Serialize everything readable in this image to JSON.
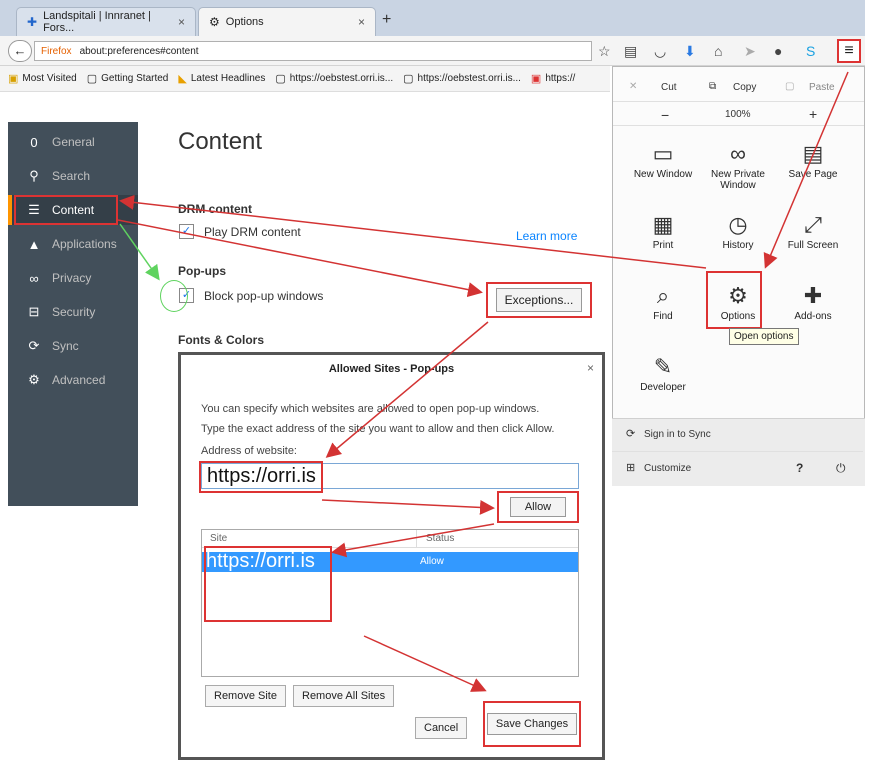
{
  "tabs": [
    {
      "label": "Landspitali | Innranet | Fors...",
      "close": "×",
      "icon": "globe-icon"
    },
    {
      "label": "Options",
      "close": "×",
      "icon": "gear-icon"
    }
  ],
  "new_tab": "+",
  "nav": {
    "back": "←",
    "identity": "Firefox",
    "url": "about:preferences#content",
    "icons": [
      "star-icon",
      "reading-list-icon",
      "pocket-icon",
      "download-icon",
      "home-icon",
      "send-icon",
      "chat-icon",
      "skype-icon"
    ],
    "menu": "≡"
  },
  "bookmarks": [
    {
      "label": "Most Visited",
      "icon": "bookmark-icon"
    },
    {
      "label": "Getting Started",
      "icon": "page-icon"
    },
    {
      "label": "Latest Headlines",
      "icon": "rss-icon"
    },
    {
      "label": "https://oebstest.orri.is...",
      "icon": "page-icon"
    },
    {
      "label": "https://oebstest.orri.is...",
      "icon": "page-icon"
    },
    {
      "label": "https://",
      "icon": "page-icon"
    }
  ],
  "sidebar": {
    "items": [
      {
        "label": "General",
        "icon": "0"
      },
      {
        "label": "Search",
        "icon": "🔍"
      },
      {
        "label": "Content",
        "icon": "☰"
      },
      {
        "label": "Applications",
        "icon": "▲"
      },
      {
        "label": "Privacy",
        "icon": "∞"
      },
      {
        "label": "Security",
        "icon": "🔒"
      },
      {
        "label": "Sync",
        "icon": "⟳"
      },
      {
        "label": "Advanced",
        "icon": "⚙"
      }
    ]
  },
  "content": {
    "title": "Content",
    "drm_heading": "DRM content",
    "drm_label": "Play DRM content",
    "learn_more": "Learn more",
    "popups_heading": "Pop-ups",
    "popups_label": "Block pop-up windows",
    "exceptions": "Exceptions...",
    "fonts_heading": "Fonts & Colors"
  },
  "menu": {
    "edit": {
      "cut": "Cut",
      "copy": "Copy",
      "paste": "Paste"
    },
    "zoom": {
      "minus": "−",
      "level": "100%",
      "plus": "+"
    },
    "items": [
      {
        "label": "New Window",
        "icon": "▭"
      },
      {
        "label": "New Private Window",
        "icon": "∞"
      },
      {
        "label": "Save Page",
        "icon": "▤"
      },
      {
        "label": "Print",
        "icon": "▦"
      },
      {
        "label": "History",
        "icon": "◷"
      },
      {
        "label": "Full Screen",
        "icon": "⤢"
      },
      {
        "label": "Find",
        "icon": "⌕"
      },
      {
        "label": "Options",
        "icon": "⚙"
      },
      {
        "label": "Add-ons",
        "icon": "✚"
      },
      {
        "label": "Developer",
        "icon": "✎"
      }
    ],
    "tooltip": "Open options",
    "sign_in": "Sign in to Sync",
    "customize": "Customize",
    "help": "?",
    "quit": "⏻"
  },
  "dialog": {
    "title": "Allowed Sites - Pop-ups",
    "close": "×",
    "description1": "You can specify which websites are allowed to open pop-up windows.",
    "description2": "Type the exact address of the site you want to allow and then click Allow.",
    "address_label": "Address of website:",
    "address_value": "https://orri.is",
    "allow": "Allow",
    "col_site": "Site",
    "col_status": "Status",
    "row_site": "https://orri.is",
    "row_status": "Allow",
    "remove_site": "Remove Site",
    "remove_all": "Remove All Sites",
    "cancel": "Cancel",
    "save": "Save Changes"
  },
  "colors": {
    "annotation": "#d33333",
    "highlight": "#3399ff",
    "sidebar": "#424f5a"
  }
}
